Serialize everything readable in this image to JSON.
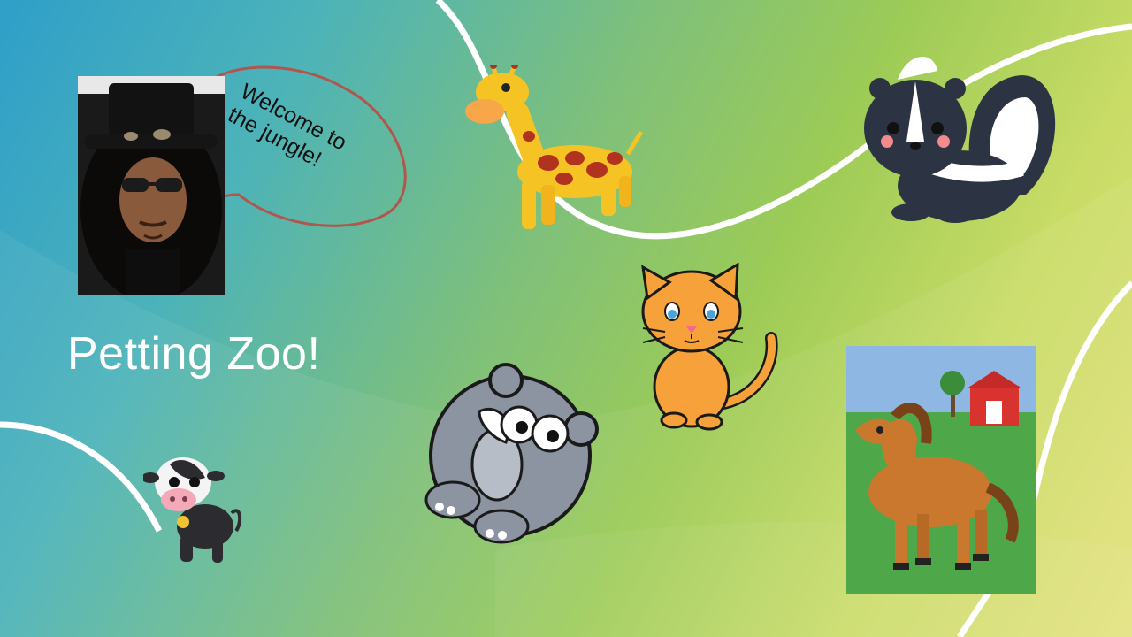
{
  "slide": {
    "speech_bubble_text": "Welcome to\nthe jungle!",
    "title": "Petting Zoo!"
  },
  "colors": {
    "background_start": "#2f9fc9",
    "background_end": "#e4e27d",
    "title_color": "#ffffff",
    "bubble_outline": "#b0564d"
  },
  "images": [
    "portrait-photo",
    "giraffe",
    "skunk",
    "cat",
    "rhino",
    "cow",
    "horse-drawing"
  ]
}
